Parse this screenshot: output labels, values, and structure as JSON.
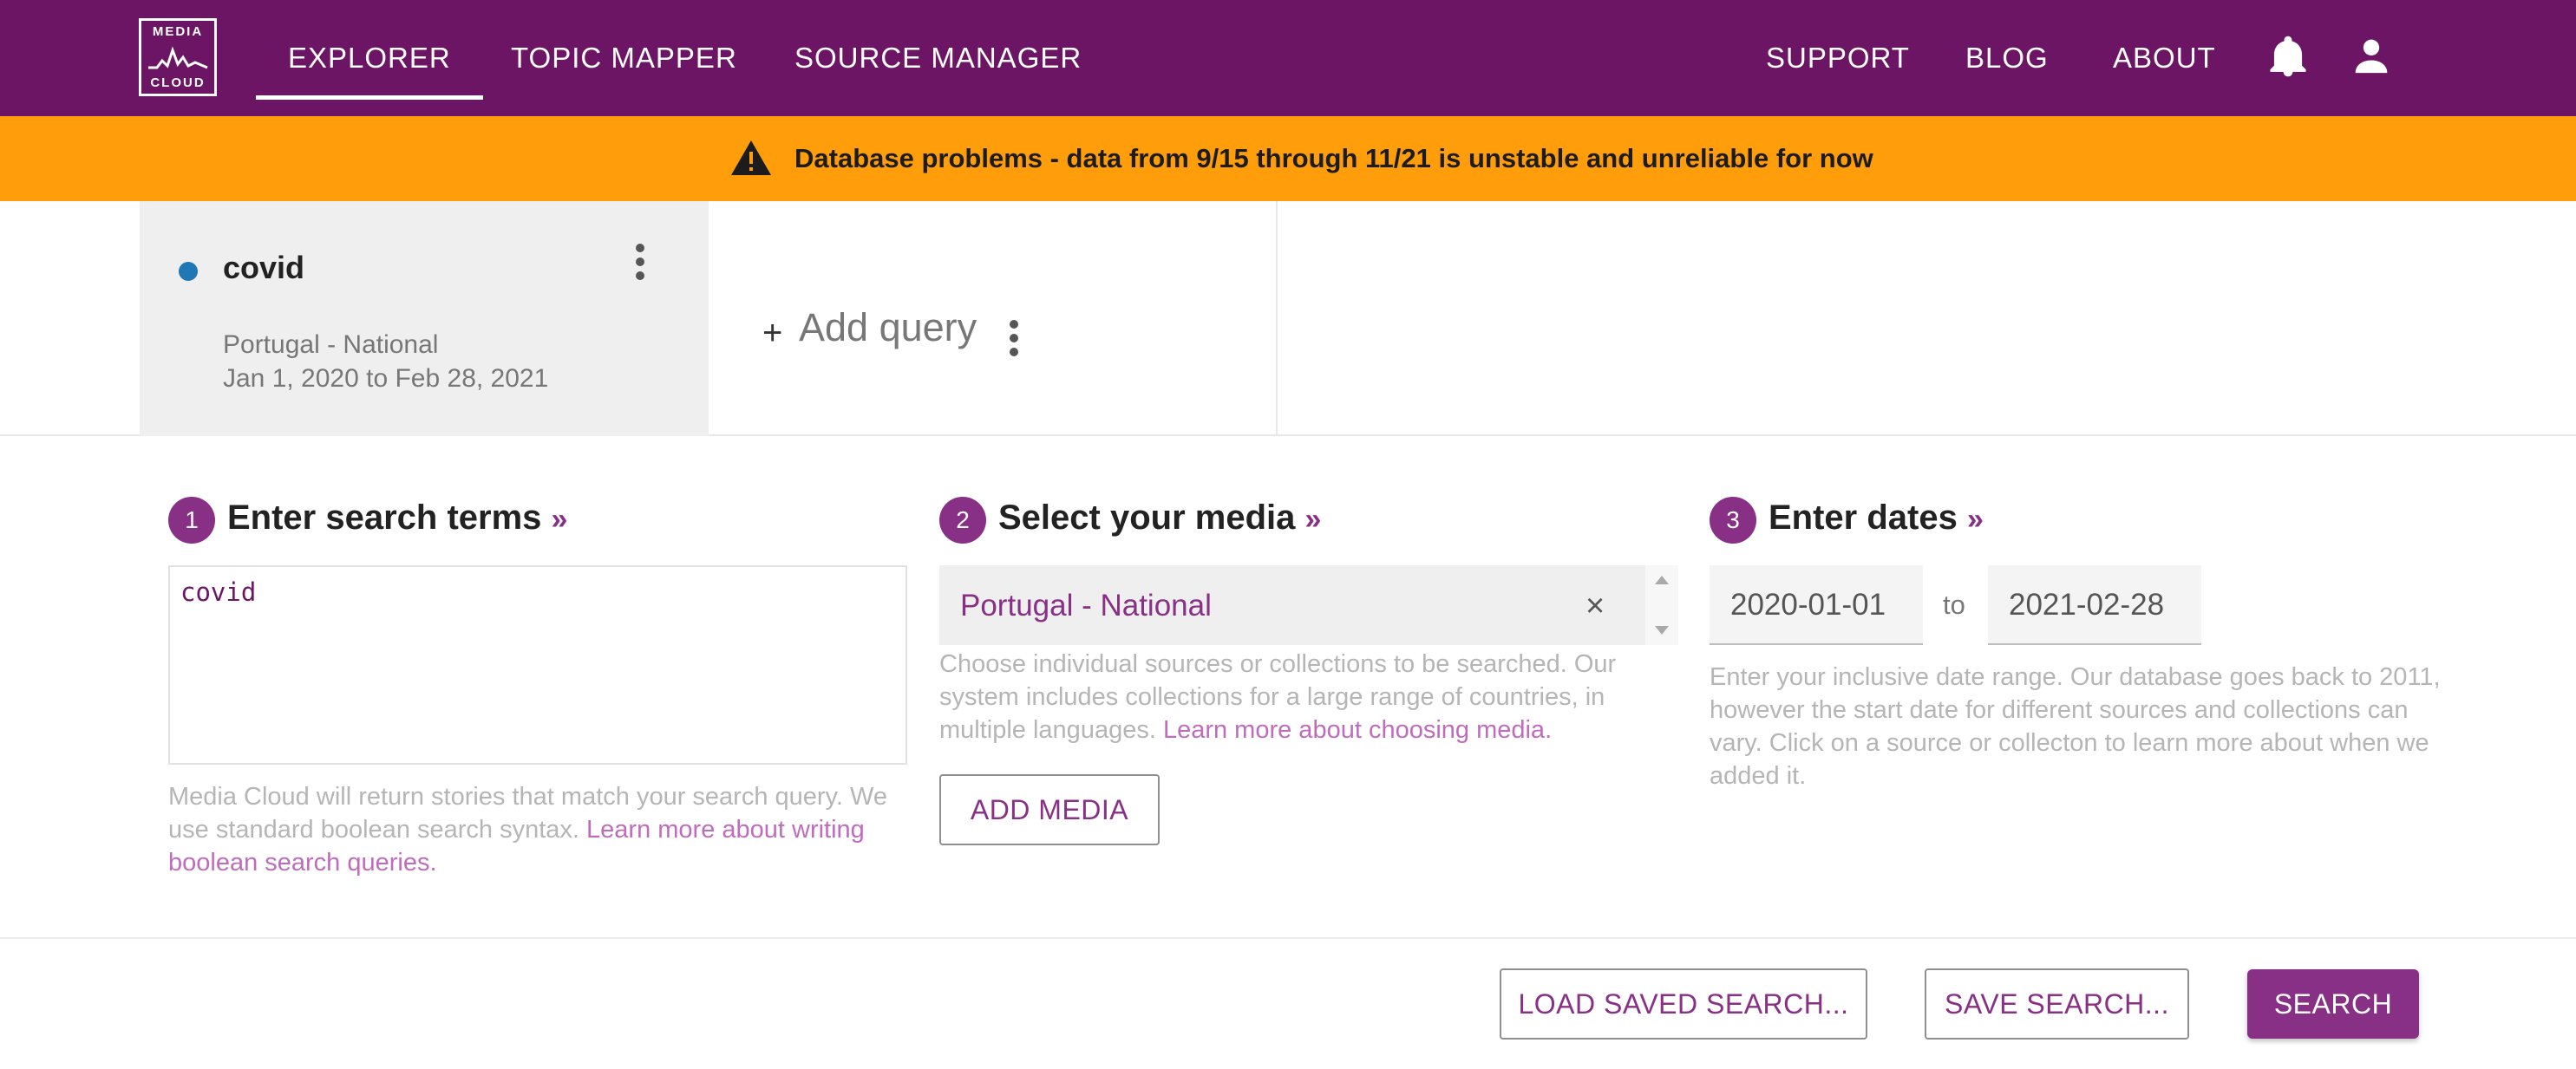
{
  "header": {
    "logo": {
      "top": "MEDIA",
      "bottom": "CLOUD"
    },
    "nav": {
      "explorer": "EXPLORER",
      "topic_mapper": "TOPIC MAPPER",
      "source_manager": "SOURCE MANAGER",
      "support": "SUPPORT",
      "blog": "BLOG",
      "about": "ABOUT"
    },
    "icons": {
      "notifications": "bell-icon",
      "account": "user-icon"
    },
    "colors": {
      "bar": "#6d1565"
    }
  },
  "banner": {
    "icon": "warning-icon",
    "message": "Database problems - data from 9/15 through 11/21 is unstable and unreliable for now",
    "color": "#ff9d0a"
  },
  "queries": {
    "items": [
      {
        "name": "covid",
        "color": "#1f77b4",
        "media": "Portugal - National",
        "dates": "Jan 1, 2020 to Feb 28, 2021"
      }
    ],
    "add_label": "Add query"
  },
  "steps": {
    "search": {
      "number": "1",
      "title": "Enter search terms",
      "value": "covid",
      "help": "Media Cloud will return stories that match your search query. We use standard boolean search syntax.",
      "help_link": "Learn more about writing boolean search queries."
    },
    "media": {
      "number": "2",
      "title": "Select your media",
      "selected": "Portugal - National",
      "help": "Choose individual sources or collections to be searched. Our system includes collections for a large range of countries, in multiple languages.",
      "help_link": "Learn more about choosing media.",
      "add_button": "ADD MEDIA"
    },
    "dates": {
      "number": "3",
      "title": "Enter dates",
      "start": "2020-01-01",
      "separator": "to",
      "end": "2021-02-28",
      "help": "Enter your inclusive date range. Our database goes back to 2011, however the start date for different sources and collections can vary. Click on a source or collecton to learn more about when we added it."
    },
    "more_glyph": "»"
  },
  "actions": {
    "load_saved": "LOAD SAVED SEARCH...",
    "save": "SAVE SEARCH...",
    "search": "SEARCH"
  },
  "accent_color": "#882f86"
}
